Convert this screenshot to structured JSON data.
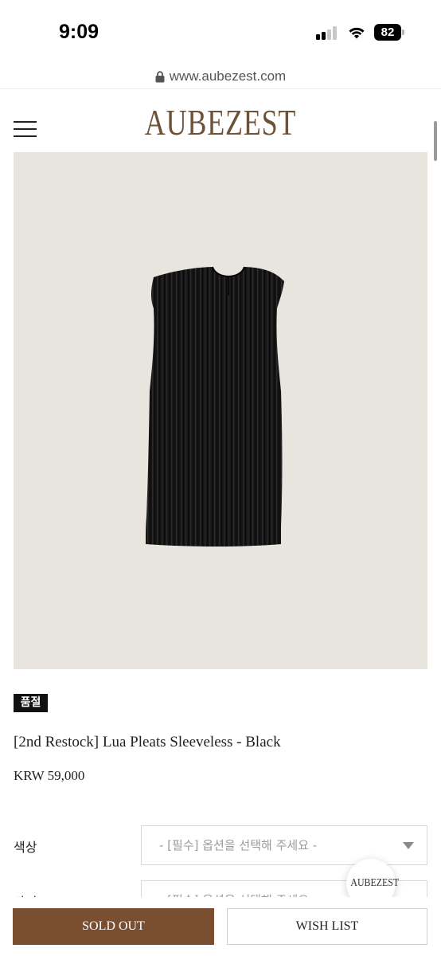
{
  "status_bar": {
    "time": "9:09",
    "battery": "82",
    "icons": [
      "signal-icon",
      "wifi-icon",
      "battery-icon"
    ]
  },
  "browser": {
    "url": "www.aubezest.com",
    "lock_icon": "lock-icon"
  },
  "header": {
    "logo": "AUBEZEST",
    "menu_icon": "hamburger-menu-icon"
  },
  "product": {
    "image_bg": "#e8e4de",
    "badge": "품절",
    "name": "[2nd Restock] Lua Pleats Sleeveless - Black",
    "price": "KRW 59,000"
  },
  "options": [
    {
      "label": "색상",
      "placeholder": "- [필수] 옵션을 선택해 주세요 -"
    },
    {
      "label": "사이즈",
      "placeholder": "- [필수] 옵션을 선택해 주세요 -"
    }
  ],
  "floating_button": {
    "label": "AUBEZEST"
  },
  "actions": {
    "primary": "SOLD OUT",
    "secondary": "WISH LIST"
  },
  "colors": {
    "brand": "#6e5238",
    "soldout_button": "#7a4e31",
    "image_background": "#e8e4de"
  }
}
